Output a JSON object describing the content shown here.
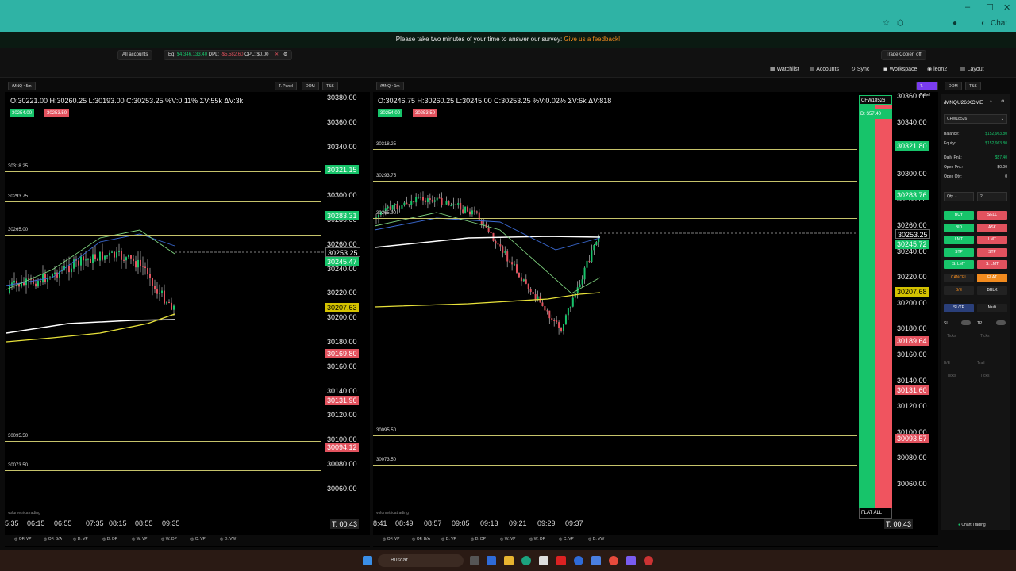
{
  "window": {
    "chat_label": "Chat"
  },
  "survey": {
    "text": "Please take two minutes of your time to answer our survey:",
    "link": "Give us a feedback!"
  },
  "accounts_bar": {
    "account_select": "All accounts",
    "eq_label": "Eq:",
    "eq_value": "$4,346,133.40",
    "dpl_label": "DPL:",
    "dpl_value": "-$5,582.60",
    "opl_label": "OPL:",
    "opl_value": "$0.00",
    "trade_copier": "Trade Copier: off"
  },
  "nav": {
    "watchlist": "Watchlist",
    "accounts": "Accounts",
    "sync": "Sync",
    "workspace": "Workspace",
    "user": "leon2",
    "layout": "Layout"
  },
  "chart_left": {
    "symbol": "/MNQ",
    "timeframe": "5m",
    "buttons": [
      "T. Panel",
      "DOM",
      "T&S"
    ],
    "ohlc": "O:30221.00  H:30260.25  L:30193.00  C:30253.25  %V:0.11%  ΣV:55k  ΔV:3k",
    "bid_tag": "30254.00",
    "ask_tag": "30253.50",
    "price_axis": [
      "30380.00",
      "30360.00",
      "30340.00",
      "30320.00",
      "30300.00",
      "30280.00",
      "30260.00",
      "30240.00",
      "30220.00",
      "30200.00",
      "30180.00",
      "30160.00",
      "30140.00",
      "30120.00",
      "30100.00",
      "30080.00",
      "30060.00"
    ],
    "price_boxes": [
      {
        "text": "30321.15",
        "color": "#17c46a"
      },
      {
        "text": "30283.31",
        "color": "#17c46a"
      },
      {
        "text": "30253.25",
        "color": "#000000"
      },
      {
        "text": "30245.47",
        "color": "#17c46a"
      },
      {
        "text": "30207.63",
        "color": "#d4c200"
      },
      {
        "text": "30169.80",
        "color": "#e2525e"
      },
      {
        "text": "30131.96",
        "color": "#e2525e"
      },
      {
        "text": "30094.12",
        "color": "#e2525e"
      }
    ],
    "levels": [
      "30318.25",
      "30293.75",
      "30265.00",
      "30095.50",
      "30073.50"
    ],
    "times": [
      "5:35",
      "06:15",
      "06:55",
      "07:35",
      "08:15",
      "08:55",
      "09:35"
    ],
    "timer": "T: 00:43",
    "bottom": [
      "OF. VP",
      "OF. B/A",
      "D. VP",
      "D. DP",
      "W. VP",
      "W. DP",
      "C. VP",
      "D. VW"
    ],
    "watermark": "volumetricatrading"
  },
  "chart_right": {
    "symbol": "/MNQ",
    "timeframe": "1m",
    "buttons": [
      "T. Panel",
      "DOM",
      "T&S"
    ],
    "ohlc": "O:30246.75  H:30260.25  L:30245.00  C:30253.25  %V:0.02%  ΣV:6k  ΔV:818",
    "bid_tag": "30254.00",
    "ask_tag": "30253.50",
    "price_axis": [
      "30360.00",
      "30340.00",
      "30320.00",
      "30300.00",
      "30280.00",
      "30260.00",
      "30240.00",
      "30220.00",
      "30200.00",
      "30180.00",
      "30160.00",
      "30140.00",
      "30120.00",
      "30100.00",
      "30080.00",
      "30060.00"
    ],
    "price_boxes": [
      {
        "text": "30321.80",
        "color": "#17c46a"
      },
      {
        "text": "30283.76",
        "color": "#17c46a"
      },
      {
        "text": "30253.25",
        "color": "#000000"
      },
      {
        "text": "30245.72",
        "color": "#17c46a"
      },
      {
        "text": "30207.68",
        "color": "#d4c200"
      },
      {
        "text": "30189.64",
        "color": "#e2525e"
      },
      {
        "text": "30131.60",
        "color": "#e2525e"
      },
      {
        "text": "30093.57",
        "color": "#e2525e"
      }
    ],
    "levels": [
      "30318.25",
      "30293.75",
      "30265.00",
      "30095.50",
      "30073.50"
    ],
    "times": [
      "8:41",
      "08:49",
      "08:57",
      "09:05",
      "09:13",
      "09:21",
      "09:29",
      "09:37"
    ],
    "timer": "T: 00:43",
    "bottom": [
      "OF. VP",
      "OF. B/A",
      "D. VP",
      "D. DP",
      "W. VP",
      "W. DP",
      "C. VP",
      "D. VW"
    ],
    "account_tag": "CFW18526",
    "pnl_tag": "D: $57.40",
    "flat_all": "FLAT ALL",
    "watermark": "volumetricatrading"
  },
  "trade_panel": {
    "symbol": "/MNQU26:XCME",
    "account": "CFW18526",
    "rows": [
      {
        "label": "Balance:",
        "value": "$152,963.80"
      },
      {
        "label": "Equity:",
        "value": "$152,963.80"
      },
      {
        "label": "Daily PnL:",
        "value": "$57.40"
      },
      {
        "label": "Open PnL:",
        "value": "$0.00"
      },
      {
        "label": "Open Qty:",
        "value": "0"
      }
    ],
    "qty_label": "Qty",
    "qty_value": "2",
    "buttons": [
      [
        "BUY",
        "SELL"
      ],
      [
        "BID",
        "ASK"
      ],
      [
        "LMT",
        "LMT"
      ],
      [
        "STP",
        "STP"
      ],
      [
        "S. LMT",
        "S. LMT"
      ]
    ],
    "cancel": "CANCEL",
    "flat": "FLAT",
    "be": "B/E",
    "bulk": "BULK",
    "sltp": "SL/TP",
    "multi": "Multi",
    "sl": "SL",
    "tp": "TP",
    "ticks": "Ticks",
    "be_label": "B/E",
    "trail": "Trail",
    "footer": "Chart Trading"
  },
  "taskbar": {
    "search_placeholder": "Buscar"
  }
}
